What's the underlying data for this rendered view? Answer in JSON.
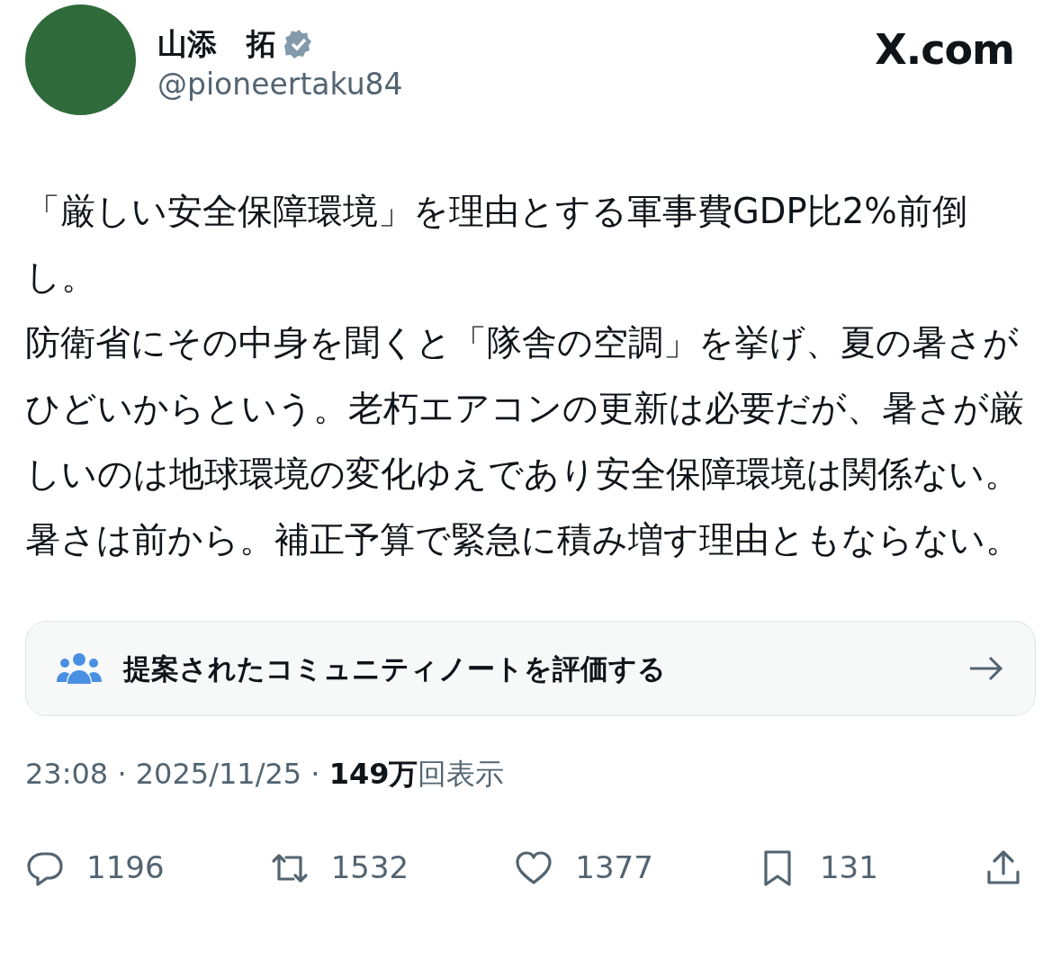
{
  "author": {
    "name": "山添　拓",
    "verified": true,
    "handle": "@pioneertaku84"
  },
  "site_label": "X.com",
  "body": [
    "「厳しい安全保障環境」を理由とする軍事費GDP比2%前倒し。",
    "防衛省にその中身を聞くと「隊舎の空調」を挙げ、夏の暑さがひどいからという。老朽エアコンの更新は必要だが、暑さが厳しいのは地球環境の変化ゆえであり安全保障環境は関係ない。暑さは前から。補正予算で緊急に積み増す理由ともならない。"
  ],
  "community_note_prompt": {
    "text": "提案されたコミュニティノートを評価する"
  },
  "meta": "23:08 · 2025/11/25 · **149万**回表示",
  "actions": [
    {
      "kind": "reply",
      "count": "1196"
    },
    {
      "kind": "repost",
      "count": "1532"
    },
    {
      "kind": "like",
      "count": "1377"
    },
    {
      "kind": "bookmark",
      "count": "131"
    },
    {
      "kind": "share"
    }
  ]
}
